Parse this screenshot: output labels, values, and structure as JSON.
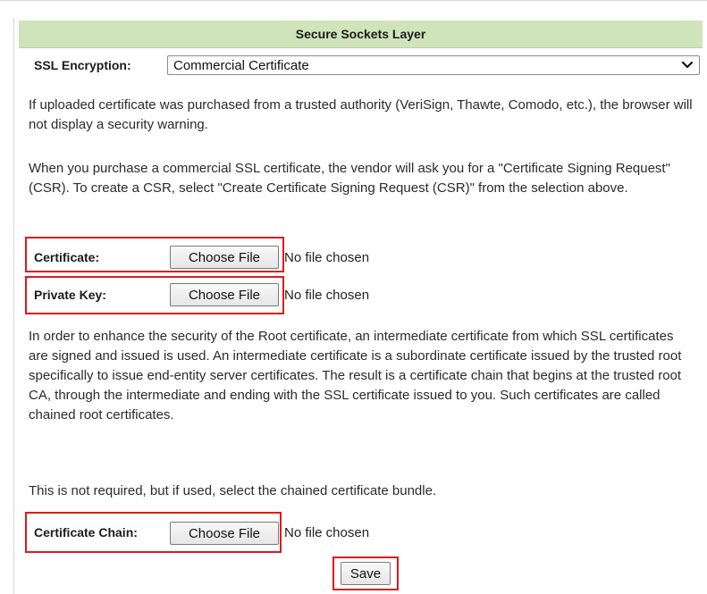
{
  "header": {
    "title": "Secure Sockets Layer"
  },
  "ssl": {
    "label": "SSL Encryption:",
    "selected": "Commercial Certificate"
  },
  "paragraphs": {
    "p1": "If uploaded certificate was purchased from a trusted authority (VeriSign, Thawte, Comodo, etc.), the browser will not display a security warning.",
    "p2": "When you purchase a commercial SSL certificate, the vendor will ask you for a \"Certificate Signing Request\" (CSR). To create a CSR, select \"Create Certificate Signing Request (CSR)\" from the selection above.",
    "p3": "In order to enhance the security of the Root certificate, an intermediate certificate from which SSL certificates are signed and issued is used. An intermediate certificate is a subordinate certificate issued by the trusted root specifically to issue end-entity server certificates. The result is a certificate chain that begins at the trusted root CA, through the intermediate and ending with the SSL certificate issued to you. Such certificates are called chained root certificates.",
    "p4": "This is not required, but if used, select the chained certificate bundle."
  },
  "files": {
    "certificate": {
      "label": "Certificate:",
      "button": "Choose File",
      "status": "No file chosen"
    },
    "private_key": {
      "label": "Private Key:",
      "button": "Choose File",
      "status": "No file chosen"
    },
    "chain": {
      "label": "Certificate Chain:",
      "button": "Choose File",
      "status": "No file chosen"
    }
  },
  "actions": {
    "save": "Save"
  },
  "colors": {
    "header_bg": "#cfe4ba",
    "highlight": "#e0191e"
  },
  "icons": {
    "select_arrow": "chevron-down-icon"
  }
}
